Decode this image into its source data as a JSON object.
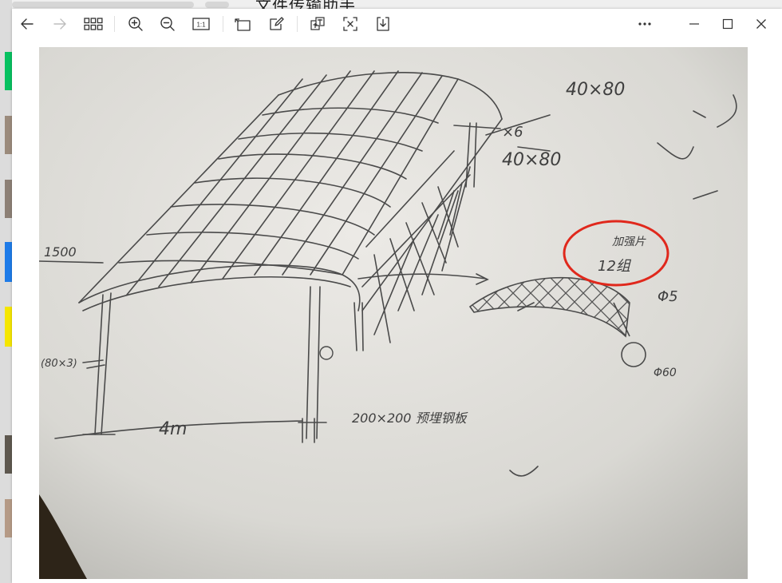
{
  "background": {
    "title": "文件传输助手"
  },
  "toolbar": {
    "back": "arrow-left-icon",
    "forward": "arrow-right-icon",
    "grid": "grid-icon",
    "zoom_in": "zoom-in-icon",
    "zoom_out": "zoom-out-icon",
    "actual_size_label": "1:1",
    "rotate": "rotate-icon",
    "edit": "edit-icon",
    "translate": "translate-icon",
    "extract_text": "extract-text-icon",
    "download": "download-icon",
    "more": "more-icon",
    "minimize": "minimize-icon",
    "maximize": "maximize-icon",
    "close": "close-icon"
  },
  "sketch": {
    "notes": {
      "top_right_a": "40×80",
      "x_mark": "×6",
      "mid_right": "40×80",
      "left_val": "1500",
      "left_side": "(80×3)",
      "span": "4m",
      "base": "200×200 预埋钢板",
      "arch_label": "加强片",
      "arch_count": "12组",
      "pipe": "Φ5",
      "pipe_dim": "Φ60"
    },
    "highlight_color": "#e0281c",
    "ink_color": "#4a4a4a"
  }
}
